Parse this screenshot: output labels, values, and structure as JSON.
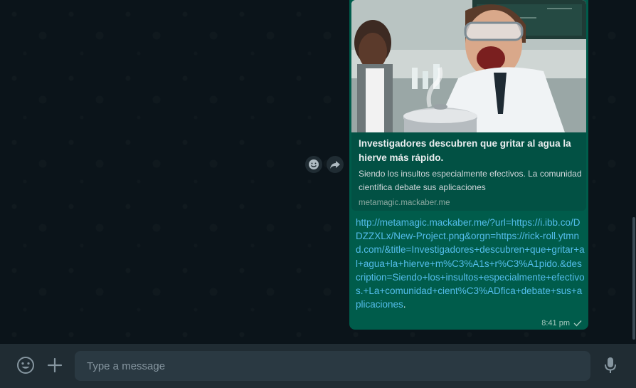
{
  "conversation": {
    "message": {
      "preview": {
        "image_alt": "AI-generated image of a screaming scientist in goggles over a steaming pot with a laughing colleague in a lab",
        "title": "Investigadores descubren que gritar al agua la hierve más rápido.",
        "description": "Siendo los insultos especialmente efectivos. La comunidad científica debate sus aplicaciones",
        "domain": "metamagic.mackaber.me"
      },
      "link_text": "http://metamagic.mackaber.me/?url=https://i.ibb.co/DDZZXLx/New-Project.png&orgn=https://rick-roll.ytmnd.com/&title=Investigadores+descubren+que+gritar+al+agua+la+hierve+m%C3%A1s+r%C3%A1pido.&description=Siendo+los+insultos+especialmente+efectivos.+La+comunidad+cient%C3%ADfica+debate+sus+aplicaciones",
      "link_suffix": ".",
      "time": "8:41 pm",
      "status_icon": "single-check-icon",
      "colors": {
        "bubble": "#005c4b",
        "link": "#53bdeb"
      }
    },
    "actions": {
      "react_icon": "emoji-react-icon",
      "forward_icon": "forward-icon"
    }
  },
  "composer": {
    "emoji_icon": "emoji-icon",
    "attach_icon": "plus-icon",
    "placeholder": "Type a message",
    "value": "",
    "mic_icon": "microphone-icon"
  }
}
